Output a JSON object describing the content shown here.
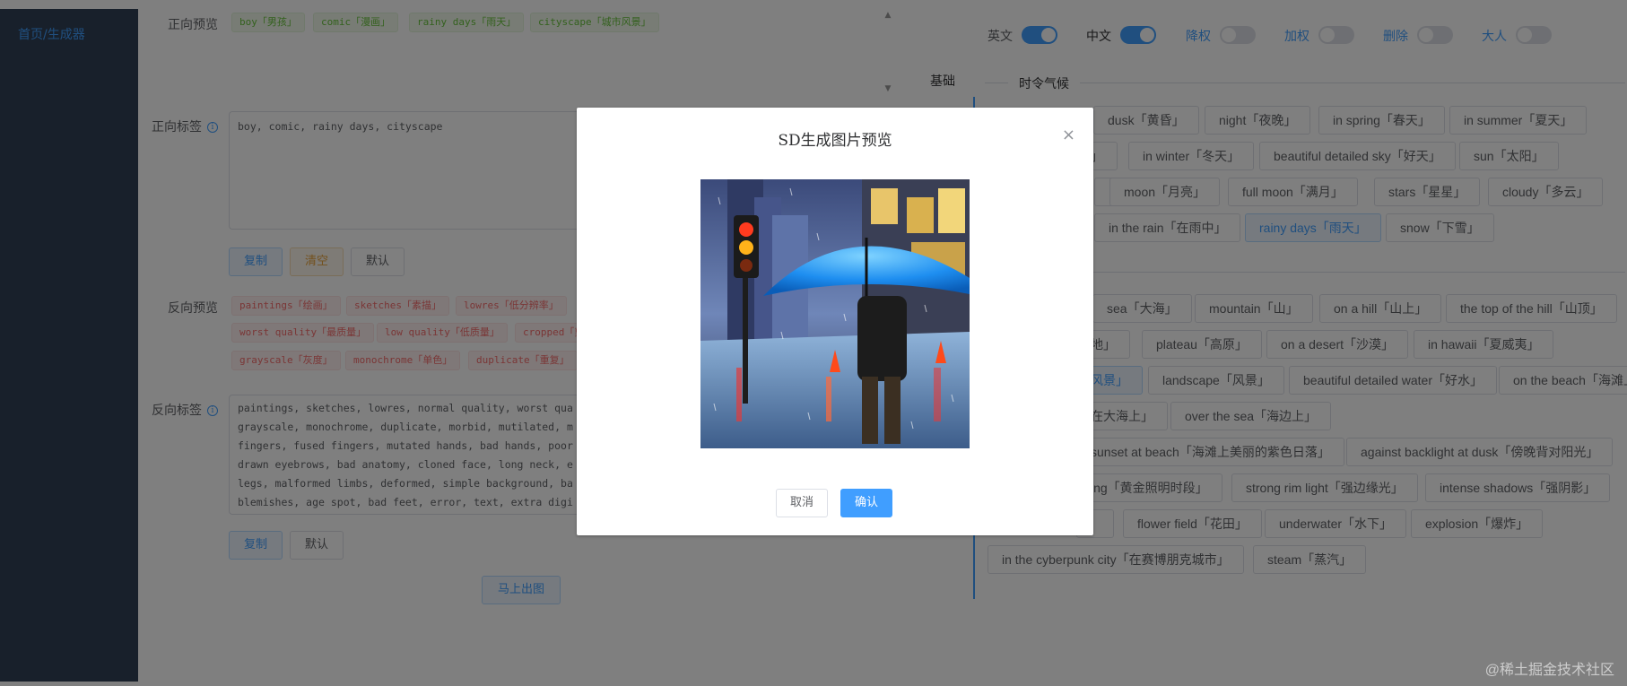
{
  "sidebar": {
    "link": "首页/生成器"
  },
  "left": {
    "positive_preview_label": "正向预览",
    "positive_preview_tags": [
      "boy「男孩」",
      "comic「漫画」",
      "rainy days「雨天」",
      "cityscape「城市风景」"
    ],
    "positive_tags_label": "正向标签",
    "positive_tags_value": "boy, comic, rainy days, cityscape",
    "positive_buttons": {
      "copy": "复制",
      "clear": "清空",
      "default": "默认"
    },
    "negative_preview_label": "反向预览",
    "negative_preview_tags_row1": [
      "paintings「绘画」",
      "sketches「素描」",
      "lowres「低分辨率」"
    ],
    "negative_preview_tags_row2": [
      "worst quality「最质量」",
      "low quality「低质量」",
      "cropped「剪"
    ],
    "negative_preview_tags_row3": [
      "grayscale「灰度」",
      "monochrome「单色」",
      "duplicate「重复」"
    ],
    "negative_tags_label": "反向标签",
    "negative_tags_lines": [
      "paintings, sketches, lowres, normal quality, worst qua",
      "grayscale, monochrome, duplicate, morbid, mutilated, m",
      "fingers, fused fingers, mutated hands, bad hands, poor",
      "drawn eyebrows, bad anatomy, cloned face, long neck, e",
      "legs, malformed limbs, deformed, simple background, ba",
      "blemishes, age spot, bad feet, error, text, extra digi"
    ],
    "negative_buttons": {
      "copy": "复制",
      "default": "默认"
    },
    "generate_button": "马上出图"
  },
  "right": {
    "switches": [
      {
        "label": "英文",
        "on": true,
        "color": "#606266"
      },
      {
        "label": "中文",
        "on": true,
        "color": "#303133"
      },
      {
        "label": "降权",
        "on": false,
        "color": "#409eff"
      },
      {
        "label": "加权",
        "on": false,
        "color": "#409eff"
      },
      {
        "label": "删除",
        "on": false,
        "color": "#409eff"
      },
      {
        "label": "大人",
        "on": false,
        "color": "#409eff"
      }
    ],
    "side_tab": "基础",
    "section_title": "时令气候",
    "tags_row1": [
      "dusk「黄昏」",
      "night「夜晚」",
      "in spring「春天」",
      "in summer「夏天」"
    ],
    "tags_row2": [
      "」",
      "in winter「冬天」",
      "beautiful detailed sky「好天」",
      "sun「太阳」"
    ],
    "tags_row3": [
      "moon「月亮」",
      "full moon「满月」",
      "stars「星星」",
      "cloudy「多云」"
    ],
    "tags_row4": [
      "in the rain「在雨中」",
      "rainy days「雨天」",
      "snow「下雪」"
    ],
    "tags_row5": [
      "sea「大海」",
      "mountain「山」",
      "on a hill「山上」",
      "the top of the hill「山顶」"
    ],
    "tags_row6": [
      "地」",
      "plateau「高原」",
      "on a desert「沙漠」",
      "in hawaii「夏威夷」"
    ],
    "tags_row7": [
      "风景」",
      "landscape「风景」",
      "beautiful detailed water「好水」",
      "on the beach「海滩上」"
    ],
    "tags_row8": [
      "在大海上」",
      "over the sea「海边上」"
    ],
    "tags_row9": [
      "sunset at beach「海滩上美丽的紫色日落」",
      "against backlight at dusk「傍晚背对阳光」"
    ],
    "tags_row10": [
      "ing「黄金照明时段」",
      "strong rim light「强边缘光」",
      "intense shadows「强阴影」"
    ],
    "tags_row11": [
      "",
      "flower field「花田」",
      "underwater「水下」",
      "explosion「爆炸」"
    ],
    "tags_row12": [
      "in the cyberpunk city「在赛博朋克城市」",
      "steam「蒸汽」"
    ]
  },
  "modal": {
    "title": "SD生成图片预览",
    "close_icon": "×",
    "cancel": "取消",
    "confirm": "确认"
  },
  "watermark": "@稀土掘金技术社区"
}
